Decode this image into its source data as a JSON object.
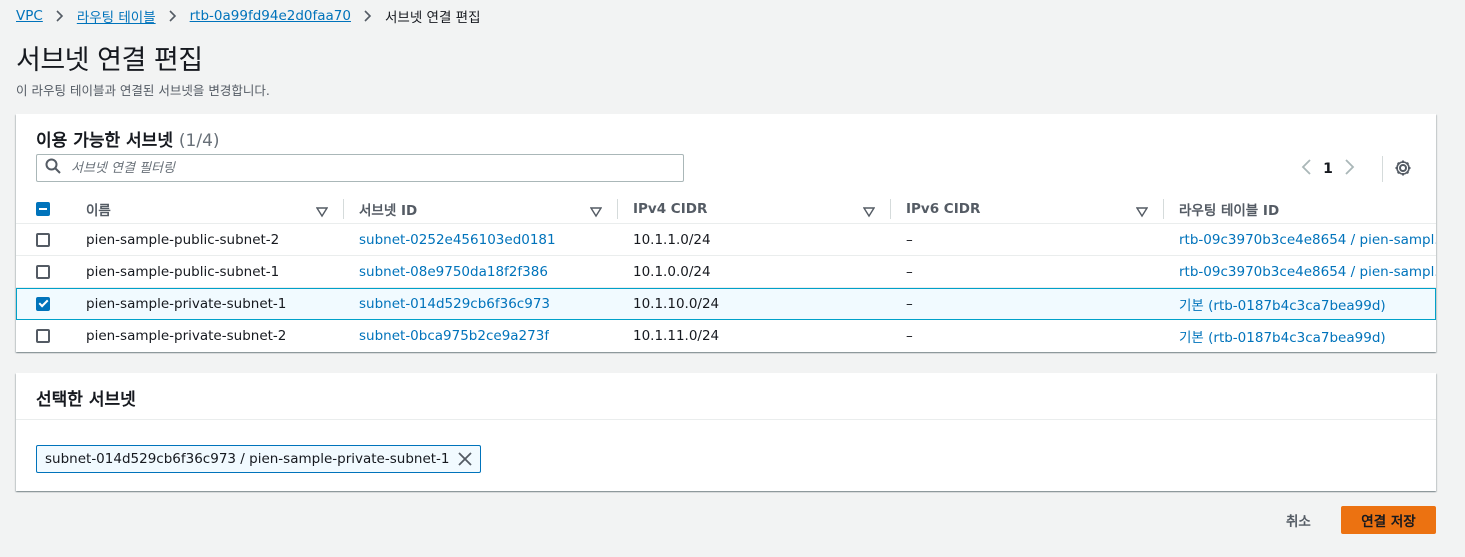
{
  "breadcrumb": {
    "items": [
      {
        "label": "VPC"
      },
      {
        "label": "라우팅 테이블"
      },
      {
        "label": "rtb-0a99fd94e2d0faa70"
      }
    ],
    "current": "서브넷 연결 편집"
  },
  "page": {
    "title": "서브넷 연결 편집",
    "description": "이 라우팅 테이블과 연결된 서브넷을 변경합니다."
  },
  "available": {
    "title": "이용 가능한 서브넷",
    "count": "(1/4)",
    "filter_placeholder": "서브넷 연결 필터링",
    "page_number": "1",
    "columns": [
      "이름",
      "서브넷 ID",
      "IPv4 CIDR",
      "IPv6 CIDR",
      "라우팅 테이블 ID"
    ],
    "rows": [
      {
        "name": "pien-sample-public-subnet-2",
        "subnet_id": "subnet-0252e456103ed0181",
        "ipv4": "10.1.1.0/24",
        "ipv6": "–",
        "route_table": "rtb-09c3970b3ce4e8654 / pien-sampl...",
        "checked": false
      },
      {
        "name": "pien-sample-public-subnet-1",
        "subnet_id": "subnet-08e9750da18f2f386",
        "ipv4": "10.1.0.0/24",
        "ipv6": "–",
        "route_table": "rtb-09c3970b3ce4e8654 / pien-sampl...",
        "checked": false
      },
      {
        "name": "pien-sample-private-subnet-1",
        "subnet_id": "subnet-014d529cb6f36c973",
        "ipv4": "10.1.10.0/24",
        "ipv6": "–",
        "route_table": "기본 (rtb-0187b4c3ca7bea99d)",
        "checked": true
      },
      {
        "name": "pien-sample-private-subnet-2",
        "subnet_id": "subnet-0bca975b2ce9a273f",
        "ipv4": "10.1.11.0/24",
        "ipv6": "–",
        "route_table": "기본 (rtb-0187b4c3ca7bea99d)",
        "checked": false
      }
    ]
  },
  "selected": {
    "title": "선택한 서브넷",
    "token": "subnet-014d529cb6f36c973 / pien-sample-private-subnet-1"
  },
  "footer": {
    "cancel_label": "취소",
    "save_label": "연결 저장"
  },
  "colors": {
    "link": "#0073bb",
    "primary_button": "#ec7211",
    "selected_row": "#f1faff"
  },
  "icons": [
    "chevron-right-icon",
    "search-icon",
    "chevron-left-icon",
    "settings-gear-icon",
    "sort-caret-icon",
    "close-icon"
  ]
}
